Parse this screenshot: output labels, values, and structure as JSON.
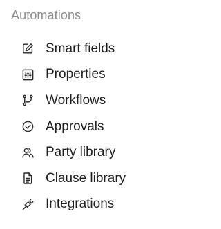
{
  "section": {
    "title": "Automations"
  },
  "items": [
    {
      "label": "Smart fields",
      "icon": "edit-square-icon"
    },
    {
      "label": "Properties",
      "icon": "sliders-icon"
    },
    {
      "label": "Workflows",
      "icon": "branch-icon"
    },
    {
      "label": "Approvals",
      "icon": "check-circle-icon"
    },
    {
      "label": "Party library",
      "icon": "users-icon"
    },
    {
      "label": "Clause library",
      "icon": "document-icon"
    },
    {
      "label": "Integrations",
      "icon": "plug-icon"
    }
  ],
  "colors": {
    "title": "#8c8c8c",
    "label": "#1f1f1f",
    "icon": "#2a2a2a",
    "background": "#ffffff"
  }
}
